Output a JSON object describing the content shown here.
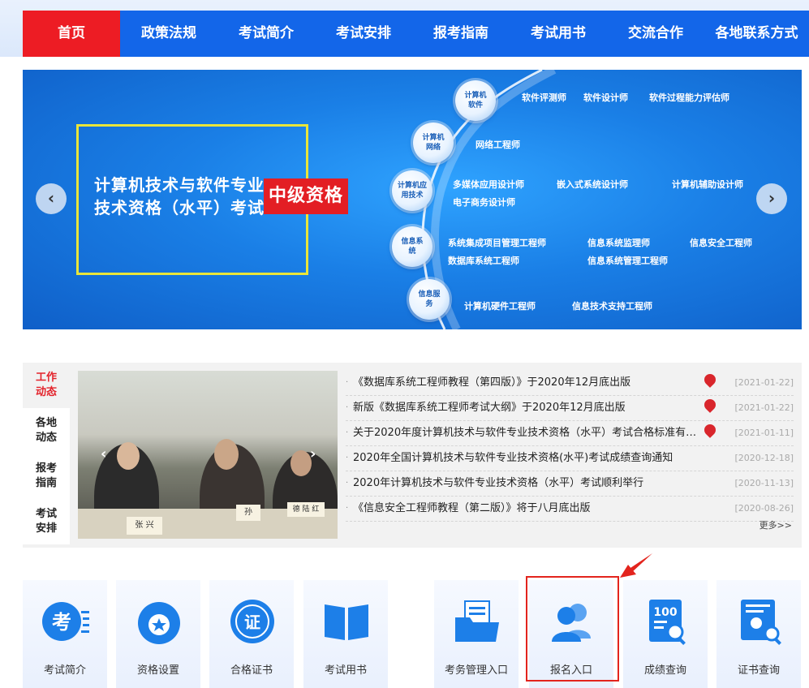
{
  "nav": {
    "items": [
      "首页",
      "政策法规",
      "考试简介",
      "考试安排",
      "报考指南",
      "考试用书",
      "交流合作",
      "各地联系方式"
    ],
    "active_index": 0
  },
  "banner": {
    "title_line1": "计算机技术与软件专业",
    "title_line2": "技术资格（水平）考试",
    "level_tag": "中级资格",
    "nodes": [
      {
        "label": "计算机软件",
        "jobs": [
          "软件评测师",
          "软件设计师",
          "软件过程能力评估师"
        ]
      },
      {
        "label": "计算机网络",
        "jobs": [
          "网络工程师"
        ]
      },
      {
        "label": "计算机应用技术",
        "jobs": [
          "多媒体应用设计师",
          "嵌入式系统设计师",
          "计算机辅助设计师",
          "电子商务设计师"
        ]
      },
      {
        "label": "信息系统",
        "jobs": [
          "系统集成项目管理工程师",
          "信息系统监理师",
          "信息安全工程师",
          "数据库系统工程师",
          "信息系统管理工程师"
        ]
      },
      {
        "label": "信息服务",
        "jobs": [
          "计算机硬件工程师",
          "信息技术支持工程师"
        ]
      }
    ],
    "prev_icon": "chevron-left-icon",
    "next_icon": "chevron-right-icon"
  },
  "side_tabs": [
    "工作动态",
    "各地动态",
    "报考指南",
    "考试安排"
  ],
  "photo": {
    "nameplates": [
      "张 兴",
      "孙",
      "德 陆 红"
    ]
  },
  "news": [
    {
      "title": "《数据库系统工程师教程（第四版）》于2020年12月底出版",
      "date": "[2021-01-22]",
      "is_new": true
    },
    {
      "title": "新版《数据库系统工程师考试大纲》于2020年12月底出版",
      "date": "[2021-01-22]",
      "is_new": true
    },
    {
      "title": "关于2020年度计算机技术与软件专业技术资格（水平）考试合格标准有关...",
      "date": "[2021-01-11]",
      "is_new": true
    },
    {
      "title": "2020年全国计算机技术与软件专业技术资格(水平)考试成绩查询通知",
      "date": "[2020-12-18]",
      "is_new": false
    },
    {
      "title": "2020年计算机技术与软件专业技术资格（水平）考试顺利举行",
      "date": "[2020-11-13]",
      "is_new": false
    },
    {
      "title": "《信息安全工程师教程（第二版）》将于八月底出版",
      "date": "[2020-08-26]",
      "is_new": false
    }
  ],
  "more_label": "更多>>",
  "cards": [
    {
      "label": "考试简介",
      "icon": "exam-icon"
    },
    {
      "label": "资格设置",
      "icon": "medal-icon"
    },
    {
      "label": "合格证书",
      "icon": "certificate-seal-icon"
    },
    {
      "label": "考试用书",
      "icon": "book-icon"
    },
    {
      "label": "考务管理入口",
      "icon": "folder-document-icon"
    },
    {
      "label": "报名入口",
      "icon": "users-icon"
    },
    {
      "label": "成绩查询",
      "icon": "score-search-icon"
    },
    {
      "label": "证书查询",
      "icon": "certificate-search-icon"
    }
  ],
  "colors": {
    "nav_bg": "#1366e9",
    "nav_active": "#ed1c24",
    "highlight": "#e3241d",
    "accent_red": "#e3232b"
  }
}
